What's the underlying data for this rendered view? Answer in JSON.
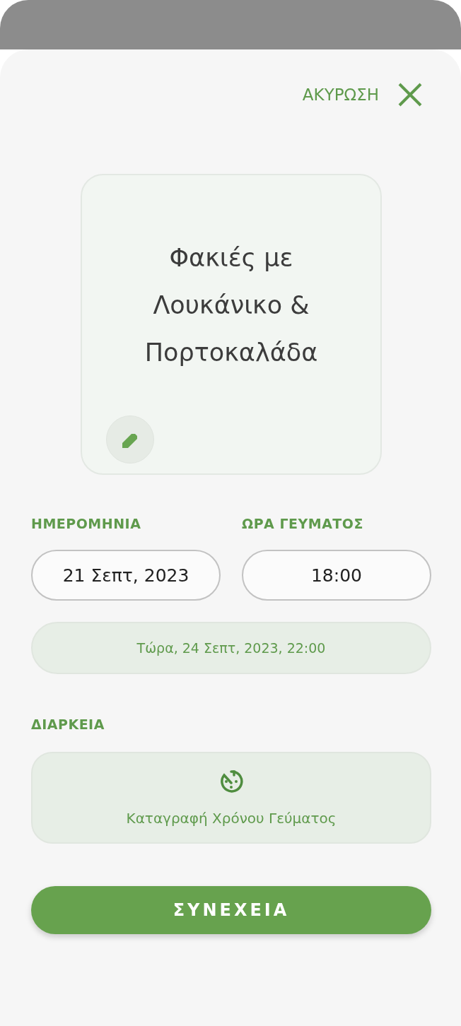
{
  "header": {
    "cancel_label": "ΑΚΥΡΩΣΗ"
  },
  "meal_card": {
    "title": "Φακιές με Λουκάνικο & Πορτοκαλάδα"
  },
  "date_field": {
    "label": "ΗΜΕΡΟΜΗΝΙΑ",
    "value": "21 Σεπτ, 2023"
  },
  "time_field": {
    "label": "ΩΡΑ ΓΕΥΜΑΤΟΣ",
    "value": "18:00"
  },
  "now_button": {
    "label": "Τώρα, 24 Σεπτ, 2023, 22:00"
  },
  "duration": {
    "label": "ΔΙΑΡΚΕΙΑ",
    "action": "Καταγραφή Χρόνου Γεύματος"
  },
  "continue_button": {
    "label": "ΣΥΝΕΧΕΙΑ"
  }
}
